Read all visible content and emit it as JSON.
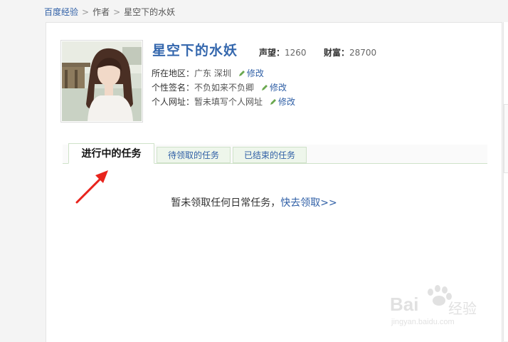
{
  "breadcrumb": {
    "home": "百度经验",
    "separator": ">",
    "section": "作者",
    "current": "星空下的水妖"
  },
  "profile": {
    "name": "星空下的水妖",
    "reputation_label": "声望：",
    "reputation_value": "1260",
    "wealth_label": "财富：",
    "wealth_value": "28700",
    "location_label": "所在地区：",
    "location_value": "广东 深圳",
    "signature_label": "个性签名：",
    "signature_value": "不负如来不负卿",
    "website_label": "个人网址：",
    "website_value": "暂未填写个人网址",
    "edit_label": "修改"
  },
  "tabs": {
    "in_progress": "进行中的任务",
    "pending": "待领取的任务",
    "ended": "已结束的任务"
  },
  "empty_state": {
    "message": "暂未领取任何日常任务，",
    "link": "快去领取>>"
  },
  "watermark": {
    "brand": "Bai",
    "brand_cn": "经验",
    "url": "jingyan.baidu.com"
  },
  "colors": {
    "link": "#2f5fa6",
    "name": "#3467ad",
    "tab_border": "#cfe2c9",
    "tab_bg": "#eef6eb",
    "arrow": "#e8231c"
  }
}
